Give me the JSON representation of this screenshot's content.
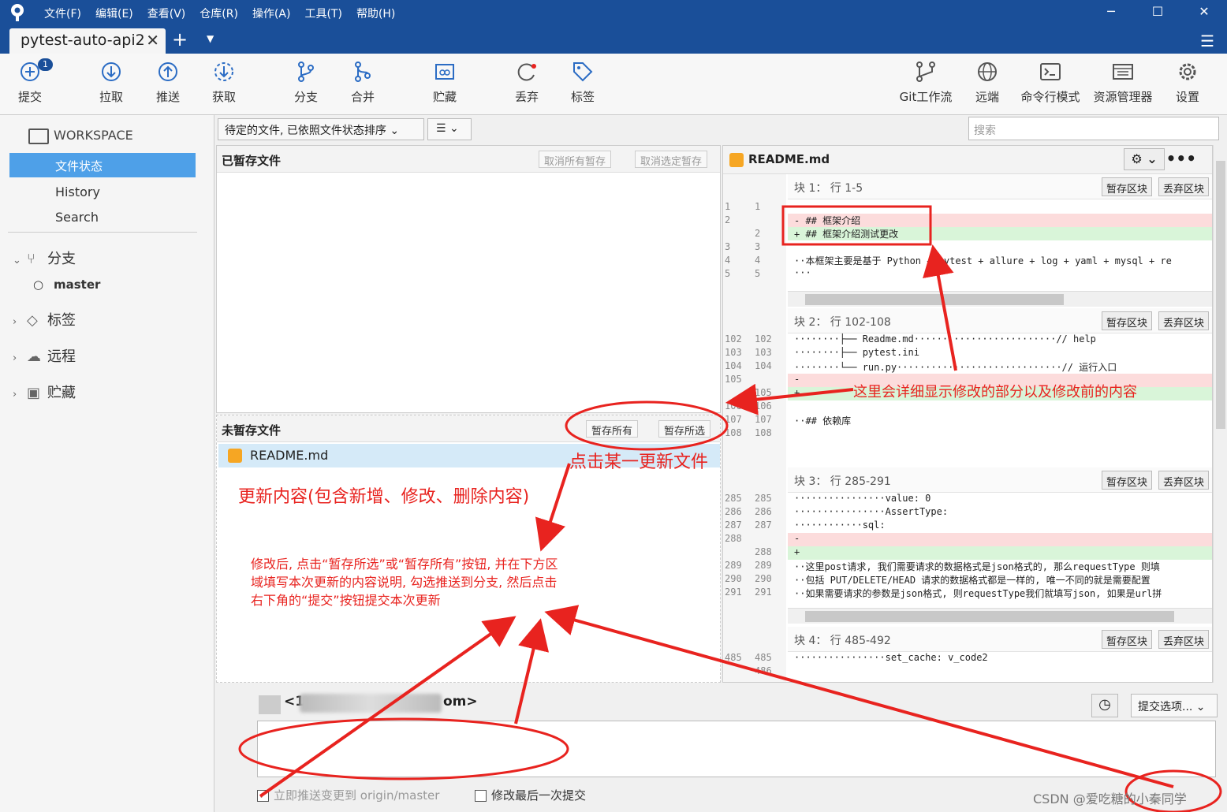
{
  "menu": [
    "文件(F)",
    "编辑(E)",
    "查看(V)",
    "仓库(R)",
    "操作(A)",
    "工具(T)",
    "帮助(H)"
  ],
  "window": {
    "minimize": "─",
    "maximize": "☐",
    "close": "✕"
  },
  "tab": {
    "title": "pytest-auto-api2",
    "close": "✕",
    "add": "+",
    "dropdown": "▼",
    "menu": "☰"
  },
  "toolbar": {
    "commit": "提交",
    "commit_badge": "1",
    "pull": "拉取",
    "push": "推送",
    "fetch": "获取",
    "branch": "分支",
    "merge": "合并",
    "stash": "贮藏",
    "discard": "丢弃",
    "tag": "标签",
    "gitflow": "Git工作流",
    "remote": "远端",
    "terminal": "命令行模式",
    "explorer": "资源管理器",
    "settings": "设置"
  },
  "sidebar": {
    "workspace": "WORKSPACE",
    "file_status": "文件状态",
    "history": "History",
    "search": "Search",
    "branches": "分支",
    "master": "master",
    "tags": "标签",
    "remotes": "远程",
    "stashes": "贮藏"
  },
  "filter": {
    "sort": "待定的文件, 已依照文件状态排序 ⌄",
    "view": "☰  ⌄",
    "search_placeholder": "搜索"
  },
  "staged": {
    "title": "已暂存文件",
    "unstage_all": "取消所有暂存",
    "unstage_selected": "取消选定暂存"
  },
  "unstaged": {
    "title": "未暂存文件",
    "stage_all": "暂存所有",
    "stage_selected": "暂存所选",
    "file": "README.md"
  },
  "diff": {
    "filename": "README.md",
    "gear": "⚙ ⌄",
    "more": "•••",
    "stage_hunk": "暂存区块",
    "discard_hunk": "丢弃区块",
    "hunks": [
      {
        "header": "块 1： 行 1-5",
        "gutter": [
          [
            "1",
            "1"
          ],
          [
            "2",
            ""
          ],
          [
            "",
            "2"
          ],
          [
            "3",
            "3"
          ],
          [
            "4",
            "4"
          ],
          [
            "5",
            "5"
          ]
        ],
        "lines": [
          {
            "type": "del",
            "text": "- ## 框架介绍"
          },
          {
            "type": "add",
            "text": "+ ## 框架介绍测试更改"
          },
          {
            "type": "ctx",
            "text": ""
          },
          {
            "type": "ctx",
            "text": "··本框架主要是基于 Python + pytest + allure + log + yaml + mysql + re"
          },
          {
            "type": "ctx",
            "text": "···"
          }
        ]
      },
      {
        "header": "块 2： 行 102-108",
        "gutter": [
          [
            "102",
            "102"
          ],
          [
            "103",
            "103"
          ],
          [
            "104",
            "104"
          ],
          [
            "105",
            ""
          ],
          [
            "",
            "105"
          ],
          [
            "106",
            "106"
          ],
          [
            "107",
            "107"
          ],
          [
            "108",
            "108"
          ]
        ],
        "lines": [
          {
            "type": "ctx",
            "text": "········├── Readme.md·························// help"
          },
          {
            "type": "ctx",
            "text": "········├── pytest.ini"
          },
          {
            "type": "ctx",
            "text": "········└── run.py·····························// 运行入口"
          },
          {
            "type": "del",
            "text": "-"
          },
          {
            "type": "add",
            "text": "+"
          },
          {
            "type": "ctx",
            "text": ""
          },
          {
            "type": "ctx",
            "text": "··## 依赖库"
          },
          {
            "type": "ctx",
            "text": ""
          }
        ]
      },
      {
        "header": "块 3： 行 285-291",
        "gutter": [
          [
            "285",
            "285"
          ],
          [
            "286",
            "286"
          ],
          [
            "287",
            "287"
          ],
          [
            "288",
            ""
          ],
          [
            "",
            "288"
          ],
          [
            "289",
            "289"
          ],
          [
            "290",
            "290"
          ],
          [
            "291",
            "291"
          ]
        ],
        "lines": [
          {
            "type": "ctx",
            "text": "················value: 0"
          },
          {
            "type": "ctx",
            "text": "················AssertType:"
          },
          {
            "type": "ctx",
            "text": "············sql:"
          },
          {
            "type": "del",
            "text": "-"
          },
          {
            "type": "add",
            "text": "+"
          },
          {
            "type": "ctx",
            "text": "··这里post请求, 我们需要请求的数据格式是json格式的, 那么requestType 则填"
          },
          {
            "type": "ctx",
            "text": "··包括 PUT/DELETE/HEAD 请求的数据格式都是一样的, 唯一不同的就是需要配置"
          },
          {
            "type": "ctx",
            "text": "··如果需要请求的参数是json格式, 则requestType我们就填写json, 如果是url拼"
          }
        ]
      },
      {
        "header": "块 4： 行 485-492",
        "gutter": [
          [
            "485",
            "485"
          ],
          [
            "",
            "486"
          ]
        ],
        "lines": [
          {
            "type": "ctx",
            "text": "················set_cache: v_code2"
          },
          {
            "type": "ctx",
            "text": ""
          }
        ]
      }
    ]
  },
  "commit": {
    "author_prefix": "<1",
    "author_suffix": "om>",
    "history_icon": "◷",
    "options": "提交选项... ⌄",
    "push_check": "立即推送变更到 origin/master",
    "amend_check": "修改最后一次提交",
    "check_mark": "✓"
  },
  "annotations": {
    "detail": "这里会详细显示修改的部分以及修改前的内容",
    "click_file": "点击某一更新文件",
    "content": "更新内容(包含新增、修改、删除内容)",
    "instruction": "修改后, 点击“暂存所选”或“暂存所有”按钮, 并在下方区域填写本次更新的内容说明, 勾选推送到分支, 然后点击右下角的“提交”按钮提交本次更新"
  },
  "watermark": "CSDN @爱吃糖的小秦同学",
  "colors": {
    "accent": "#1a4f99",
    "selection": "#4ea0e8",
    "annotation": "#e8231f",
    "added": "#d9f5d9",
    "deleted": "#fcdcdc"
  }
}
